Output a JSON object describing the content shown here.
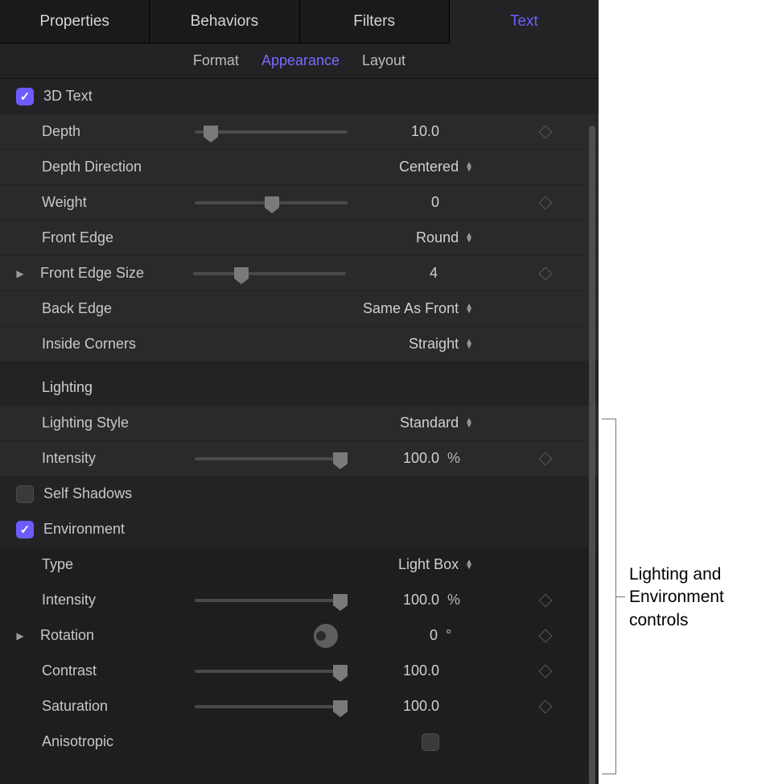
{
  "tabs": {
    "main": [
      {
        "label": "Properties",
        "active": false
      },
      {
        "label": "Behaviors",
        "active": false
      },
      {
        "label": "Filters",
        "active": false
      },
      {
        "label": "Text",
        "active": true
      }
    ],
    "sub": [
      {
        "label": "Format",
        "active": false
      },
      {
        "label": "Appearance",
        "active": true
      },
      {
        "label": "Layout",
        "active": false
      }
    ]
  },
  "section_3d": {
    "title": "3D Text",
    "checked": true,
    "depth": {
      "label": "Depth",
      "value": "10.0",
      "slider_pos": 0.08
    },
    "depth_direction": {
      "label": "Depth Direction",
      "value": "Centered"
    },
    "weight": {
      "label": "Weight",
      "value": "0",
      "slider_pos": 0.5
    },
    "front_edge": {
      "label": "Front Edge",
      "value": "Round"
    },
    "front_edge_size": {
      "label": "Front Edge Size",
      "value": "4",
      "slider_pos": 0.3
    },
    "back_edge": {
      "label": "Back Edge",
      "value": "Same As Front"
    },
    "inside_corners": {
      "label": "Inside Corners",
      "value": "Straight"
    }
  },
  "section_lighting": {
    "title": "Lighting",
    "lighting_style": {
      "label": "Lighting Style",
      "value": "Standard"
    },
    "intensity": {
      "label": "Intensity",
      "value": "100.0",
      "unit": "%",
      "slider_pos": 1.0
    }
  },
  "self_shadows": {
    "label": "Self Shadows",
    "checked": false
  },
  "environment": {
    "label": "Environment",
    "checked": true,
    "type": {
      "label": "Type",
      "value": "Light Box"
    },
    "intensity": {
      "label": "Intensity",
      "value": "100.0",
      "unit": "%",
      "slider_pos": 1.0
    },
    "rotation": {
      "label": "Rotation",
      "value": "0",
      "unit": "°"
    },
    "contrast": {
      "label": "Contrast",
      "value": "100.0",
      "slider_pos": 1.0
    },
    "saturation": {
      "label": "Saturation",
      "value": "100.0",
      "slider_pos": 1.0
    },
    "anisotropic": {
      "label": "Anisotropic",
      "checked": false
    }
  },
  "annotation": "Lighting and Environment controls"
}
